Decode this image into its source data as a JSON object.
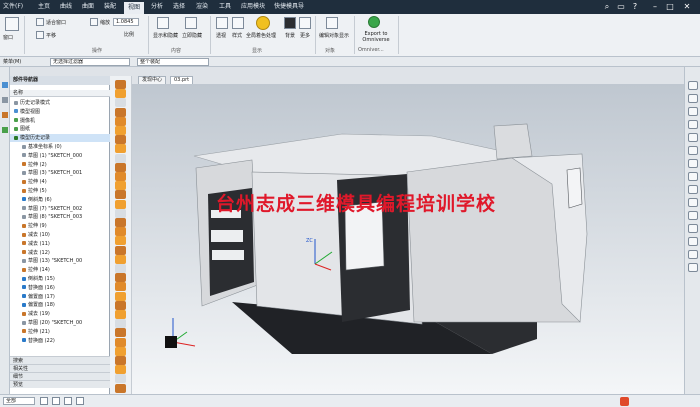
{
  "title_bar": {
    "file_menu": "文件(F)",
    "tabs": [
      "主页",
      "曲线",
      "曲面",
      "装配",
      "视图",
      "分析",
      "选择",
      "渲染",
      "工具",
      "应用模块",
      "快捷模具导"
    ],
    "active_tab": "视图"
  },
  "ribbon": {
    "window_label": "窗口",
    "fit_window_label": "适合窗口",
    "translate_label": "平移",
    "scale_label": "缩放",
    "scale_value": "1.0845",
    "ratio_label": "比例",
    "show_hide_label": "显示和隐藏",
    "immediate_hide_label": "立即隐藏",
    "edges_label": "透视",
    "style_label": "样式",
    "full_shading_label": "全局着色处理",
    "background_label": "背景",
    "more_label": "更多",
    "edit_object_display_label": "编辑对象显示",
    "export_label": "Export to Omniverse",
    "groups": {
      "operation": "操作",
      "content": "内容",
      "display": "显示",
      "object": "对象",
      "omniverse": "Omniver..."
    }
  },
  "filter_bar": {
    "menu_label": "菜单(M)",
    "type_filter": "无选择过滤器",
    "scope_filter": "整个装配"
  },
  "navigator": {
    "title": "部件导航器",
    "column_header": "名称",
    "items": [
      {
        "label": "历史记录模式",
        "color": "#8a96a3"
      },
      {
        "label": "模型视图",
        "color": "#4a8fd1"
      },
      {
        "label": "摄像机",
        "color": "#4aa04a"
      },
      {
        "label": "图纸",
        "color": "#4aa04a"
      },
      {
        "label": "模型历史记录",
        "color": "#2a7a2a"
      },
      {
        "label": "基准坐标系 (0)",
        "color": "#8a96a3"
      },
      {
        "label": "草图 (1) \"SKETCH_000",
        "color": "#8a96a3"
      },
      {
        "label": "拉伸 (2)",
        "color": "#c9762a"
      },
      {
        "label": "草图 (3) \"SKETCH_001",
        "color": "#8a96a3"
      },
      {
        "label": "拉伸 (4)",
        "color": "#c9762a"
      },
      {
        "label": "拉伸 (5)",
        "color": "#c9762a"
      },
      {
        "label": "倒斜角 (6)",
        "color": "#2a7ac9"
      },
      {
        "label": "草图 (7) \"SKETCH_002",
        "color": "#8a96a3"
      },
      {
        "label": "草图 (8) \"SKETCH_003",
        "color": "#8a96a3"
      },
      {
        "label": "拉伸 (9)",
        "color": "#c9762a"
      },
      {
        "label": "减去 (10)",
        "color": "#c9762a"
      },
      {
        "label": "减去 (11)",
        "color": "#c9762a"
      },
      {
        "label": "减去 (12)",
        "color": "#c9762a"
      },
      {
        "label": "草图 (13) \"SKETCH_00",
        "color": "#8a96a3"
      },
      {
        "label": "拉伸 (14)",
        "color": "#c9762a"
      },
      {
        "label": "倒斜角 (15)",
        "color": "#2a7ac9"
      },
      {
        "label": "替换面 (16)",
        "color": "#2a7ac9"
      },
      {
        "label": "偏置面 (17)",
        "color": "#2a7ac9"
      },
      {
        "label": "偏置面 (18)",
        "color": "#2a7ac9"
      },
      {
        "label": "减去 (19)",
        "color": "#c9762a"
      },
      {
        "label": "草图 (20) \"SKETCH_00",
        "color": "#8a96a3"
      },
      {
        "label": "拉伸 (21)",
        "color": "#c9762a"
      },
      {
        "label": "替换面 (22)",
        "color": "#2a7ac9"
      }
    ],
    "selected_index": 4,
    "panels": [
      "搜索",
      "相关性",
      "细节",
      "预览"
    ]
  },
  "document_tabs": {
    "home_tab": "发现中心",
    "part_tab": "03.prt"
  },
  "viewport": {
    "watermark": "台州志成三维模具编程培训学校",
    "triad_labels": [
      "ZC",
      "YC",
      "XC"
    ],
    "machine_colors": {
      "body": "#d7d9dc",
      "panel_light": "#eceef0",
      "panel_dark": "#2b2d31",
      "base": "#202226"
    }
  },
  "status_bar": {
    "filter": "全部"
  }
}
